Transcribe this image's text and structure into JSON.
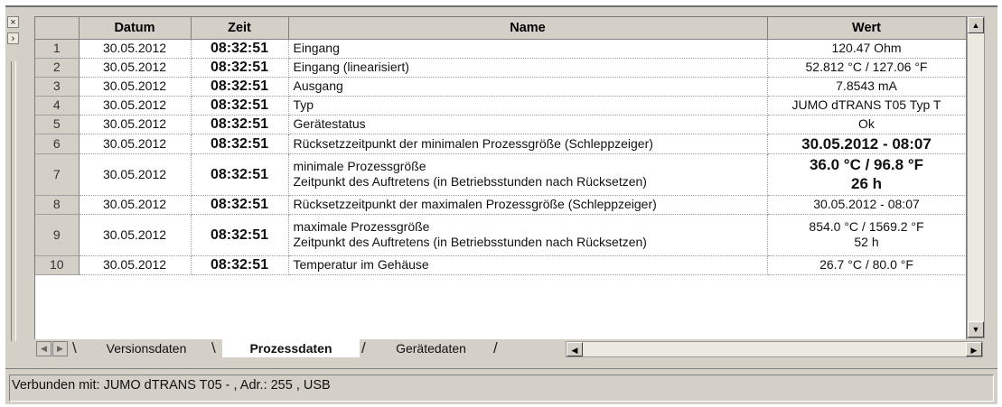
{
  "table": {
    "columns": [
      "",
      "Datum",
      "Zeit",
      "Name",
      "Wert"
    ],
    "rows": [
      {
        "n": "1",
        "date": "30.05.2012",
        "time": "08:32:51",
        "name": [
          "Eingang"
        ],
        "value": [
          "120.47 Ohm"
        ],
        "bold_value": false
      },
      {
        "n": "2",
        "date": "30.05.2012",
        "time": "08:32:51",
        "name": [
          "Eingang (linearisiert)"
        ],
        "value": [
          "52.812 °C / 127.06 °F"
        ],
        "bold_value": false
      },
      {
        "n": "3",
        "date": "30.05.2012",
        "time": "08:32:51",
        "name": [
          "Ausgang"
        ],
        "value": [
          "7.8543 mA"
        ],
        "bold_value": false
      },
      {
        "n": "4",
        "date": "30.05.2012",
        "time": "08:32:51",
        "name": [
          "Typ"
        ],
        "value": [
          "JUMO dTRANS T05 Typ T"
        ],
        "bold_value": false
      },
      {
        "n": "5",
        "date": "30.05.2012",
        "time": "08:32:51",
        "name": [
          "Gerätestatus"
        ],
        "value": [
          "Ok"
        ],
        "bold_value": false
      },
      {
        "n": "6",
        "date": "30.05.2012",
        "time": "08:32:51",
        "name": [
          "Rücksetzzeitpunkt der minimalen Prozessgröße (Schleppzeiger)"
        ],
        "value": [
          "30.05.2012 - 08:07"
        ],
        "bold_value": true
      },
      {
        "n": "7",
        "date": "30.05.2012",
        "time": "08:32:51",
        "name": [
          "minimale Prozessgröße",
          "Zeitpunkt des Auftretens (in Betriebsstunden nach Rücksetzen)"
        ],
        "value": [
          "36.0 °C / 96.8 °F",
          "26 h"
        ],
        "bold_value": true
      },
      {
        "n": "8",
        "date": "30.05.2012",
        "time": "08:32:51",
        "name": [
          "Rücksetzzeitpunkt der maximalen Prozessgröße (Schleppzeiger)"
        ],
        "value": [
          "30.05.2012 - 08:07"
        ],
        "bold_value": false
      },
      {
        "n": "9",
        "date": "30.05.2012",
        "time": "08:32:51",
        "name": [
          "maximale Prozessgröße",
          "Zeitpunkt des Auftretens (in Betriebsstunden nach Rücksetzen)"
        ],
        "value": [
          "854.0 °C / 1569.2 °F",
          "52 h"
        ],
        "bold_value": false
      },
      {
        "n": "10",
        "date": "30.05.2012",
        "time": "08:32:51",
        "name": [
          "Temperatur im Gehäuse"
        ],
        "value": [
          "26.7 °C / 80.0 °F"
        ],
        "bold_value": false
      }
    ]
  },
  "tabs": [
    {
      "label": "Versionsdaten",
      "active": false
    },
    {
      "label": "Prozessdaten",
      "active": true
    },
    {
      "label": "Gerätedaten",
      "active": false
    }
  ],
  "gutter": {
    "close_glyph": "×",
    "expand_glyph": "›"
  },
  "icons": {
    "scroll_up": "arrow-up-icon",
    "scroll_down": "arrow-down-icon",
    "scroll_left": "arrow-left-icon",
    "scroll_right": "arrow-right-icon",
    "tab_first": "tab-nav-left-icon",
    "tab_last": "tab-nav-right-icon"
  },
  "status": {
    "text": "Verbunden mit: JUMO dTRANS T05 -  , Adr.: 255 , USB"
  },
  "colors": {
    "face": "#d4d0c8",
    "grid_bg": "#ffffff",
    "active_tab": "#ffffff"
  }
}
